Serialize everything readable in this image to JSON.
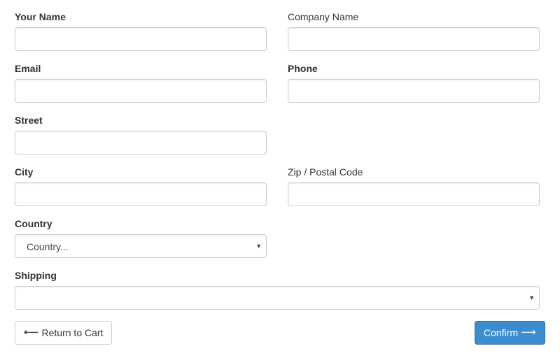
{
  "fields": {
    "your_name": {
      "label": "Your Name",
      "value": "",
      "placeholder": ""
    },
    "company_name": {
      "label": "Company Name",
      "value": "",
      "placeholder": ""
    },
    "email": {
      "label": "Email",
      "value": "",
      "placeholder": ""
    },
    "phone": {
      "label": "Phone",
      "value": "",
      "placeholder": ""
    },
    "street": {
      "label": "Street",
      "value": "",
      "placeholder": ""
    },
    "city": {
      "label": "City",
      "value": "",
      "placeholder": ""
    },
    "zip": {
      "label": "Zip / Postal Code",
      "value": "",
      "placeholder": ""
    },
    "country": {
      "label": "Country",
      "selected": "Country..."
    },
    "shipping": {
      "label": "Shipping",
      "selected": ""
    }
  },
  "buttons": {
    "return_label": "Return to Cart",
    "confirm_label": "Confirm"
  },
  "icons": {
    "return": "arrow-left-icon",
    "confirm": "arrow-right-icon",
    "dropdown": "caret-down-icon"
  },
  "colors": {
    "primary": "#3c8dd0",
    "border": "#cccccc",
    "text": "#333333"
  }
}
